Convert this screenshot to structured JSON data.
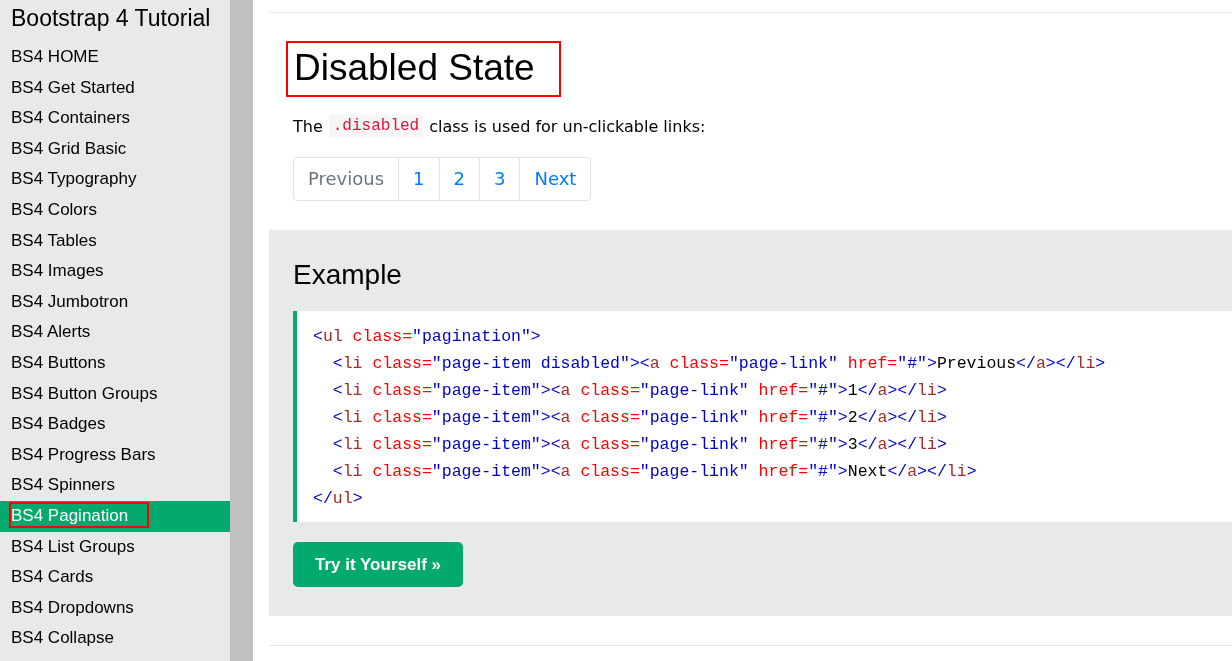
{
  "sidebar": {
    "title": "Bootstrap 4 Tutorial",
    "annotate_selected": true,
    "items": [
      {
        "label": "BS4 HOME",
        "selected": false
      },
      {
        "label": "BS4 Get Started",
        "selected": false
      },
      {
        "label": "BS4 Containers",
        "selected": false
      },
      {
        "label": "BS4 Grid Basic",
        "selected": false
      },
      {
        "label": "BS4 Typography",
        "selected": false
      },
      {
        "label": "BS4 Colors",
        "selected": false
      },
      {
        "label": "BS4 Tables",
        "selected": false
      },
      {
        "label": "BS4 Images",
        "selected": false
      },
      {
        "label": "BS4 Jumbotron",
        "selected": false
      },
      {
        "label": "BS4 Alerts",
        "selected": false
      },
      {
        "label": "BS4 Buttons",
        "selected": false
      },
      {
        "label": "BS4 Button Groups",
        "selected": false
      },
      {
        "label": "BS4 Badges",
        "selected": false
      },
      {
        "label": "BS4 Progress Bars",
        "selected": false
      },
      {
        "label": "BS4 Spinners",
        "selected": false
      },
      {
        "label": "BS4 Pagination",
        "selected": true
      },
      {
        "label": "BS4 List Groups",
        "selected": false
      },
      {
        "label": "BS4 Cards",
        "selected": false
      },
      {
        "label": "BS4 Dropdowns",
        "selected": false
      },
      {
        "label": "BS4 Collapse",
        "selected": false
      }
    ]
  },
  "main": {
    "heading": {
      "text": "Disabled State",
      "annotated": true
    },
    "intro": {
      "before": "The",
      "code": ".disabled",
      "after": "class is used for un-clickable links:"
    },
    "pagination": [
      {
        "label": "Previous",
        "disabled": true
      },
      {
        "label": "1",
        "disabled": false
      },
      {
        "label": "2",
        "disabled": false
      },
      {
        "label": "3",
        "disabled": false
      },
      {
        "label": "Next",
        "disabled": false
      }
    ],
    "example": {
      "title": "Example",
      "code_lines": [
        [
          {
            "kind": "bracket",
            "t": "<"
          },
          {
            "kind": "tag",
            "t": "ul"
          },
          {
            "kind": "attr",
            "t": " class="
          },
          {
            "kind": "value",
            "t": "\"pagination\""
          },
          {
            "kind": "bracket",
            "t": ">"
          }
        ],
        [
          {
            "kind": "bracket",
            "t": "  <"
          },
          {
            "kind": "tag",
            "t": "li"
          },
          {
            "kind": "attr",
            "t": " class="
          },
          {
            "kind": "value",
            "t": "\"page-item disabled\""
          },
          {
            "kind": "bracket",
            "t": "><"
          },
          {
            "kind": "tag",
            "t": "a"
          },
          {
            "kind": "attr",
            "t": " class="
          },
          {
            "kind": "value",
            "t": "\"page-link\""
          },
          {
            "kind": "attr",
            "t": " href="
          },
          {
            "kind": "value",
            "t": "\"#\""
          },
          {
            "kind": "bracket",
            "t": ">"
          },
          {
            "kind": "text",
            "t": "Previous"
          },
          {
            "kind": "bracket",
            "t": "</"
          },
          {
            "kind": "tag",
            "t": "a"
          },
          {
            "kind": "bracket",
            "t": "></"
          },
          {
            "kind": "tag",
            "t": "li"
          },
          {
            "kind": "bracket",
            "t": ">"
          }
        ],
        [
          {
            "kind": "bracket",
            "t": "  <"
          },
          {
            "kind": "tag",
            "t": "li"
          },
          {
            "kind": "attr",
            "t": " class="
          },
          {
            "kind": "value",
            "t": "\"page-item\""
          },
          {
            "kind": "bracket",
            "t": "><"
          },
          {
            "kind": "tag",
            "t": "a"
          },
          {
            "kind": "attr",
            "t": " class="
          },
          {
            "kind": "value",
            "t": "\"page-link\""
          },
          {
            "kind": "attr",
            "t": " href="
          },
          {
            "kind": "value",
            "t": "\"#\""
          },
          {
            "kind": "bracket",
            "t": ">"
          },
          {
            "kind": "text",
            "t": "1"
          },
          {
            "kind": "bracket",
            "t": "</"
          },
          {
            "kind": "tag",
            "t": "a"
          },
          {
            "kind": "bracket",
            "t": "></"
          },
          {
            "kind": "tag",
            "t": "li"
          },
          {
            "kind": "bracket",
            "t": ">"
          }
        ],
        [
          {
            "kind": "bracket",
            "t": "  <"
          },
          {
            "kind": "tag",
            "t": "li"
          },
          {
            "kind": "attr",
            "t": " class="
          },
          {
            "kind": "value",
            "t": "\"page-item\""
          },
          {
            "kind": "bracket",
            "t": "><"
          },
          {
            "kind": "tag",
            "t": "a"
          },
          {
            "kind": "attr",
            "t": " class="
          },
          {
            "kind": "value",
            "t": "\"page-link\""
          },
          {
            "kind": "attr",
            "t": " href="
          },
          {
            "kind": "value",
            "t": "\"#\""
          },
          {
            "kind": "bracket",
            "t": ">"
          },
          {
            "kind": "text",
            "t": "2"
          },
          {
            "kind": "bracket",
            "t": "</"
          },
          {
            "kind": "tag",
            "t": "a"
          },
          {
            "kind": "bracket",
            "t": "></"
          },
          {
            "kind": "tag",
            "t": "li"
          },
          {
            "kind": "bracket",
            "t": ">"
          }
        ],
        [
          {
            "kind": "bracket",
            "t": "  <"
          },
          {
            "kind": "tag",
            "t": "li"
          },
          {
            "kind": "attr",
            "t": " class="
          },
          {
            "kind": "value",
            "t": "\"page-item\""
          },
          {
            "kind": "bracket",
            "t": "><"
          },
          {
            "kind": "tag",
            "t": "a"
          },
          {
            "kind": "attr",
            "t": " class="
          },
          {
            "kind": "value",
            "t": "\"page-link\""
          },
          {
            "kind": "attr",
            "t": " href="
          },
          {
            "kind": "value",
            "t": "\"#\""
          },
          {
            "kind": "bracket",
            "t": ">"
          },
          {
            "kind": "text",
            "t": "3"
          },
          {
            "kind": "bracket",
            "t": "</"
          },
          {
            "kind": "tag",
            "t": "a"
          },
          {
            "kind": "bracket",
            "t": "></"
          },
          {
            "kind": "tag",
            "t": "li"
          },
          {
            "kind": "bracket",
            "t": ">"
          }
        ],
        [
          {
            "kind": "bracket",
            "t": "  <"
          },
          {
            "kind": "tag",
            "t": "li"
          },
          {
            "kind": "attr",
            "t": " class="
          },
          {
            "kind": "value",
            "t": "\"page-item\""
          },
          {
            "kind": "bracket",
            "t": "><"
          },
          {
            "kind": "tag",
            "t": "a"
          },
          {
            "kind": "attr",
            "t": " class="
          },
          {
            "kind": "value",
            "t": "\"page-link\""
          },
          {
            "kind": "attr",
            "t": " href="
          },
          {
            "kind": "value",
            "t": "\"#\""
          },
          {
            "kind": "bracket",
            "t": ">"
          },
          {
            "kind": "text",
            "t": "Next"
          },
          {
            "kind": "bracket",
            "t": "</"
          },
          {
            "kind": "tag",
            "t": "a"
          },
          {
            "kind": "bracket",
            "t": "></"
          },
          {
            "kind": "tag",
            "t": "li"
          },
          {
            "kind": "bracket",
            "t": ">"
          }
        ],
        [
          {
            "kind": "bracket",
            "t": "</"
          },
          {
            "kind": "tag",
            "t": "ul"
          },
          {
            "kind": "bracket",
            "t": ">"
          }
        ]
      ],
      "button": "Try it Yourself »"
    }
  }
}
